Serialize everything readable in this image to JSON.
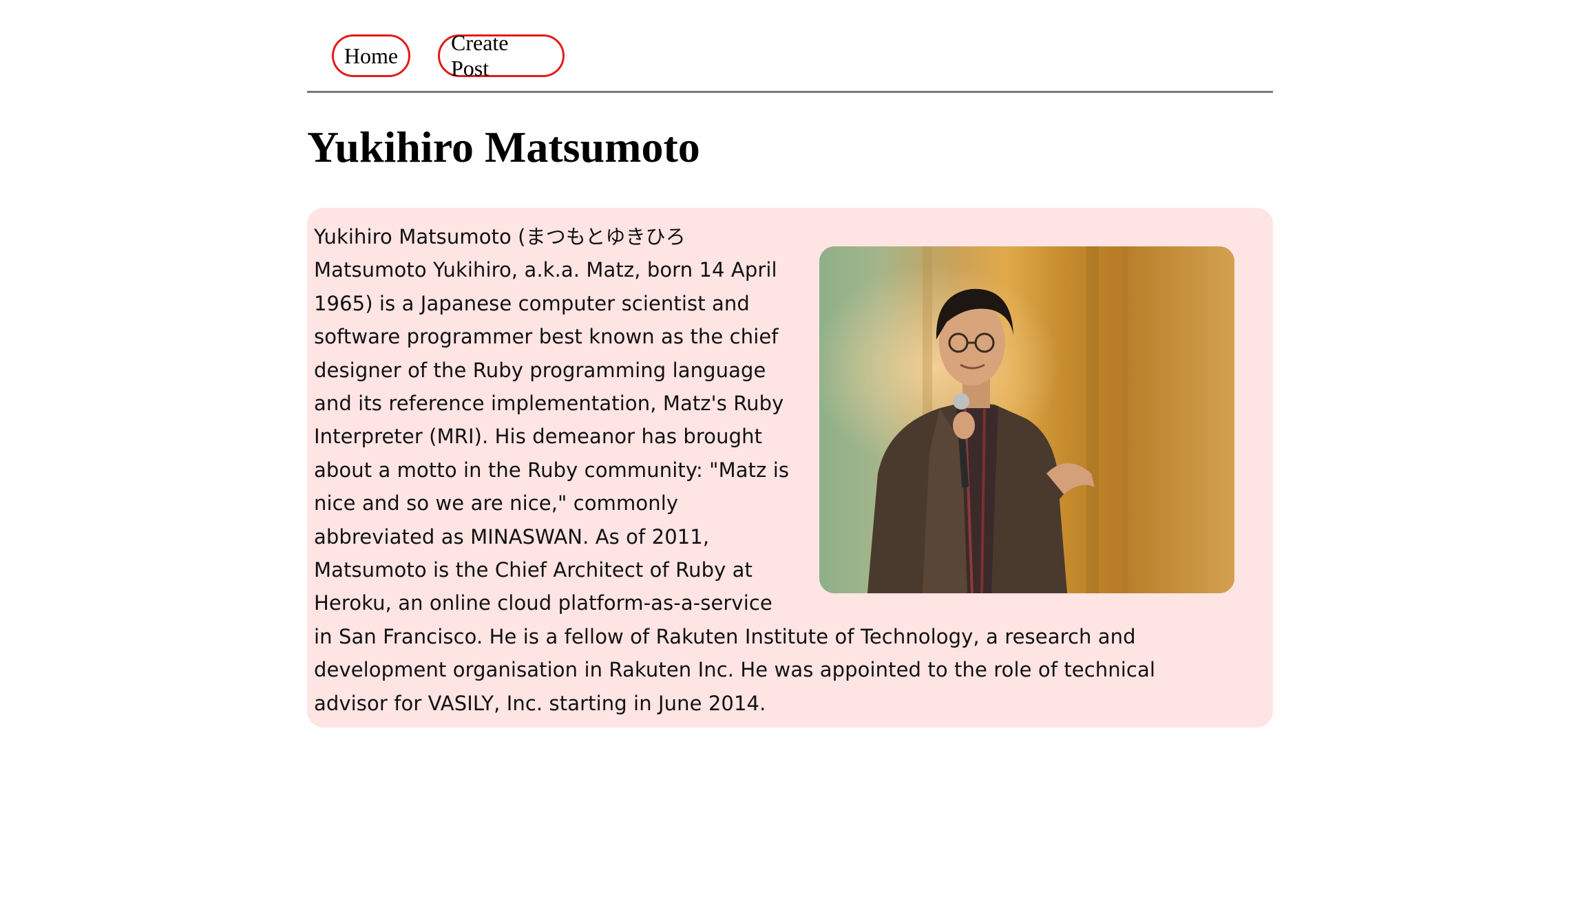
{
  "nav": {
    "home_label": "Home",
    "create_post_label": "Create Post"
  },
  "page": {
    "title": "Yukihiro Matsumoto"
  },
  "bio": {
    "text": "Yukihiro Matsumoto (まつもとゆきひろ Matsumoto Yukihiro, a.k.a. Matz, born 14 April 1965) is a Japanese computer scientist and software programmer best known as the chief designer of the Ruby programming language and its reference implementation, Matz's Ruby Interpreter (MRI). His demeanor has brought about a motto in the Ruby community: \"Matz is nice and so we are nice,\" commonly abbreviated as MINASWAN. As of 2011, Matsumoto is the Chief Architect of Ruby at Heroku, an online cloud platform-as-a-service in San Francisco. He is a fellow of Rakuten Institute of Technology, a research and development organisation in Rakuten Inc. He was appointed to the role of technical advisor for VASILY, Inc. starting in June 2014.",
    "photo_alt": "Yukihiro Matsumoto speaking with microphone"
  },
  "colors": {
    "nav_border": "#e11b1b",
    "card_background": "#ffe4e4",
    "divider": "#777777"
  }
}
